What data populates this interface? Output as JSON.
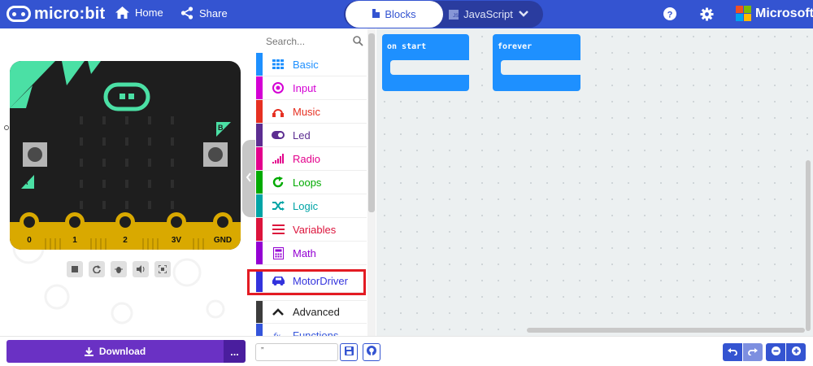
{
  "header": {
    "app_name": "micro:bit",
    "home_label": "Home",
    "share_label": "Share",
    "blocks_tab": "Blocks",
    "javascript_tab": "JavaScript",
    "brand": "Microsoft",
    "colors": {
      "header_bg": "#3454d1",
      "active_tab_text": "#3454d1"
    }
  },
  "simulator": {
    "pins": [
      "0",
      "1",
      "2",
      "3V",
      "GND"
    ],
    "button_a": "A",
    "button_b": "B",
    "controls": [
      "stop-icon",
      "restart-icon",
      "debug-icon",
      "mute-icon",
      "fullscreen-icon"
    ]
  },
  "toolbox": {
    "search_placeholder": "Search...",
    "categories": [
      {
        "label": "Basic",
        "color": "#1e90ff",
        "icon": "grid-icon"
      },
      {
        "label": "Input",
        "color": "#d400d4",
        "icon": "input-icon"
      },
      {
        "label": "Music",
        "color": "#e63022",
        "icon": "headphones-icon"
      },
      {
        "label": "Led",
        "color": "#5c2d91",
        "icon": "toggle-icon"
      },
      {
        "label": "Radio",
        "color": "#e3008c",
        "icon": "signal-icon"
      },
      {
        "label": "Loops",
        "color": "#00aa00",
        "icon": "loop-icon"
      },
      {
        "label": "Logic",
        "color": "#00a4a6",
        "icon": "shuffle-icon"
      },
      {
        "label": "Variables",
        "color": "#dc143c",
        "icon": "lines-icon"
      },
      {
        "label": "Math",
        "color": "#9400d3",
        "icon": "calculator-icon"
      },
      {
        "label": "MotorDriver",
        "color": "#3333dd",
        "icon": "car-icon"
      },
      {
        "label": "Advanced",
        "color": "#3c3c3c",
        "icon": "chevron-up-icon"
      },
      {
        "label": "Functions",
        "color": "#3455db",
        "icon": "function-icon"
      }
    ]
  },
  "workspace": {
    "blocks": [
      "on start",
      "forever"
    ],
    "block_color": "#1e90ff"
  },
  "bottom": {
    "download_label": "Download",
    "more_label": "...",
    "project_name": "”"
  }
}
